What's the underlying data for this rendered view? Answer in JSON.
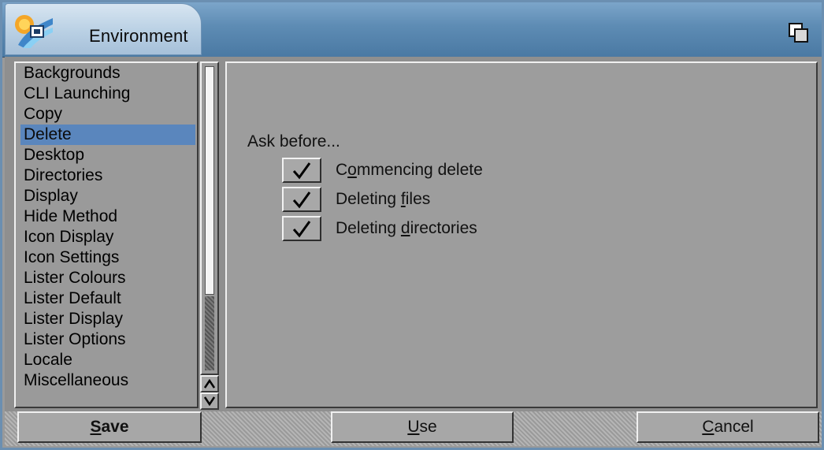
{
  "window": {
    "title": "Environment",
    "icon": "environment-app-icon",
    "depth_gadget_icon": "window-depth-icon"
  },
  "sidebar": {
    "items": [
      {
        "label": "Backgrounds",
        "selected": false
      },
      {
        "label": "CLI Launching",
        "selected": false
      },
      {
        "label": "Copy",
        "selected": false
      },
      {
        "label": "Delete",
        "selected": true
      },
      {
        "label": "Desktop",
        "selected": false
      },
      {
        "label": "Directories",
        "selected": false
      },
      {
        "label": "Display",
        "selected": false
      },
      {
        "label": "Hide Method",
        "selected": false
      },
      {
        "label": "Icon Display",
        "selected": false
      },
      {
        "label": "Icon Settings",
        "selected": false
      },
      {
        "label": "Lister Colours",
        "selected": false
      },
      {
        "label": "Lister Default",
        "selected": false
      },
      {
        "label": "Lister Display",
        "selected": false
      },
      {
        "label": "Lister Options",
        "selected": false
      },
      {
        "label": "Locale",
        "selected": false
      },
      {
        "label": "Miscellaneous",
        "selected": false
      }
    ],
    "scroll_up_icon": "scroll-up-icon",
    "scroll_down_icon": "scroll-down-icon"
  },
  "panel": {
    "heading": "Ask before...",
    "options": [
      {
        "pre": "C",
        "key": "o",
        "post": "mmencing delete",
        "checked": true
      },
      {
        "pre": "Deleting ",
        "key": "f",
        "post": "iles",
        "checked": true
      },
      {
        "pre": "Deleting ",
        "key": "d",
        "post": "irectories",
        "checked": true
      }
    ]
  },
  "buttons": {
    "save": {
      "key": "S",
      "rest": "ave"
    },
    "use": {
      "key": "U",
      "rest": "se"
    },
    "cancel": {
      "key": "C",
      "rest": "ancel"
    }
  },
  "colors": {
    "selection": "#5a86bd",
    "titlebar": "#5e8cb4",
    "background": "#9a9a9a"
  }
}
